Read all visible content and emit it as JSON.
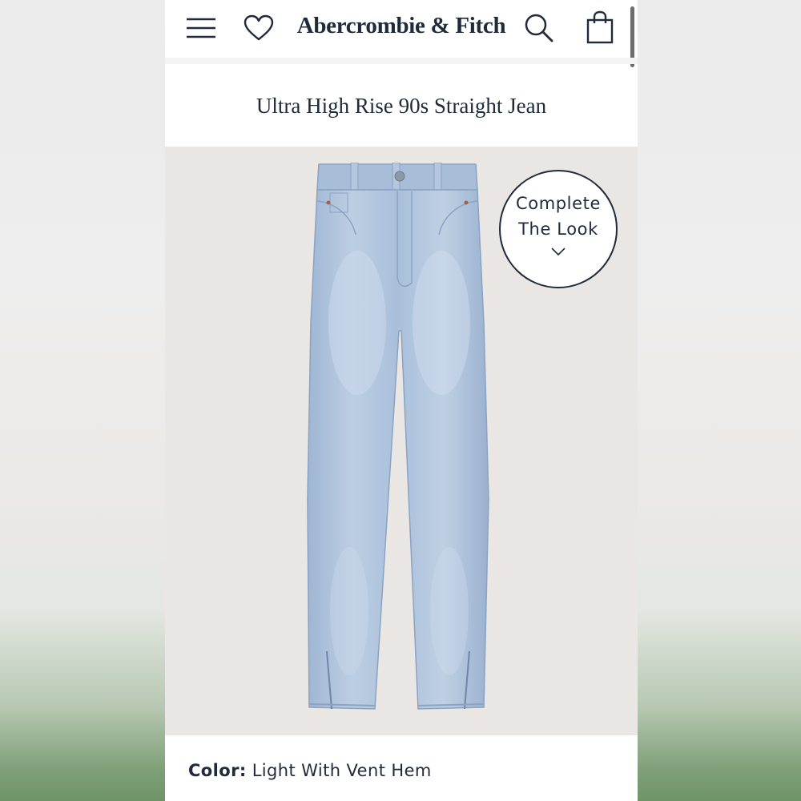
{
  "header": {
    "brand": "Abercrombie & Fitch",
    "menu_icon": "hamburger-menu-icon",
    "wishlist_icon": "heart-icon",
    "search_icon": "search-icon",
    "bag_icon": "shopping-bag-icon"
  },
  "product": {
    "title": "Ultra High Rise 90s Straight Jean",
    "image": "light-wash-straight-jeans-with-vent-hem",
    "complete_the_look": {
      "line1": "Complete",
      "line2": "The Look",
      "icon": "chevron-down-icon"
    },
    "color": {
      "label": "Color:",
      "value": "Light With Vent Hem"
    }
  },
  "colors": {
    "text_primary": "#1f2a3a",
    "image_background": "#e9e6e3",
    "denim_light": "#b5c8de",
    "denim_mid": "#9db4d1"
  }
}
